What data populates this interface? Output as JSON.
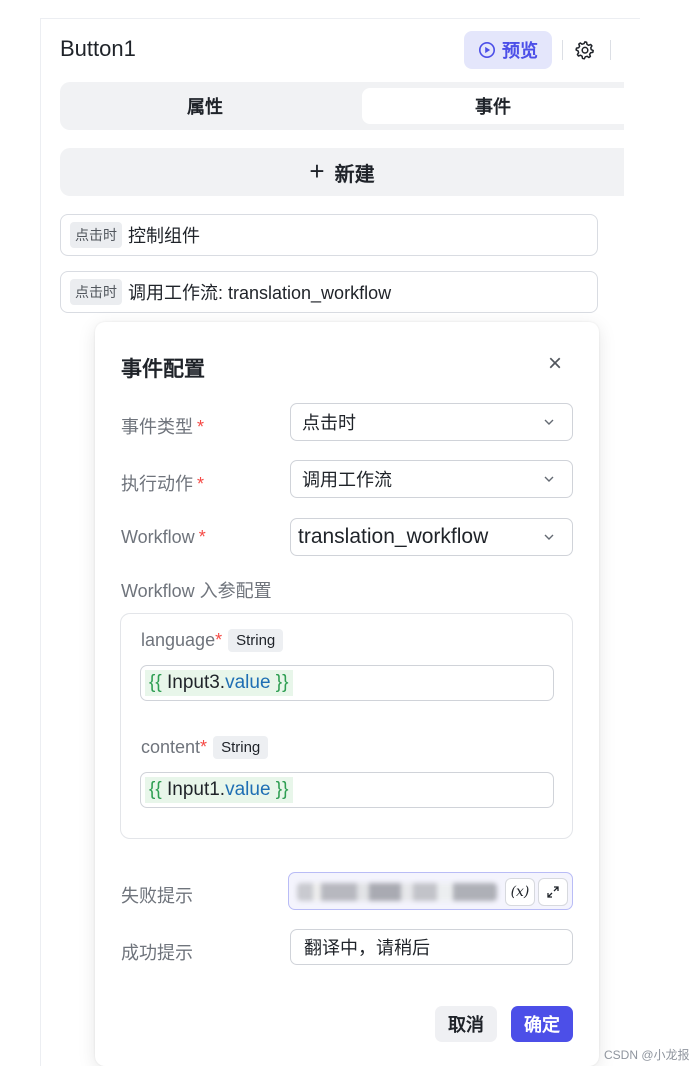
{
  "header": {
    "title": "Button1",
    "preview_label": "预览"
  },
  "tabs": [
    {
      "label": "属性",
      "active": false
    },
    {
      "label": "事件",
      "active": true
    }
  ],
  "new_button": {
    "plus": "+",
    "label": "新建"
  },
  "events": [
    {
      "tag": "点击时",
      "text": "控制组件"
    },
    {
      "tag": "点击时",
      "text": "调用工作流: translation_workflow"
    }
  ],
  "dialog": {
    "title": "事件配置",
    "close": "×",
    "fields": {
      "event_type": {
        "label": "事件类型",
        "value": "点击时"
      },
      "action": {
        "label": "执行动作",
        "value": "调用工作流"
      },
      "workflow": {
        "label": "Workflow",
        "value": "translation_workflow"
      }
    },
    "required_mark": "*",
    "workflow_params_label": "Workflow 入参配置",
    "params": [
      {
        "name": "language",
        "type": "String",
        "open": "{{ ",
        "ident": "Input3.",
        "prop": "value",
        "close": " }}"
      },
      {
        "name": "content",
        "type": "String",
        "open": "{{ ",
        "ident": "Input1.",
        "prop": "value",
        "close": " }}"
      }
    ],
    "fail_tip": {
      "label": "失败提示",
      "fx": "(x)"
    },
    "success_tip": {
      "label": "成功提示",
      "value": "翻译中，请稍后"
    },
    "cancel_label": "取消",
    "confirm_label": "确定"
  },
  "watermark": "CSDN @小龙报",
  "colors": {
    "accent": "#4c4fe8",
    "required": "#f54a45",
    "code_bg": "#e8f6ea"
  }
}
